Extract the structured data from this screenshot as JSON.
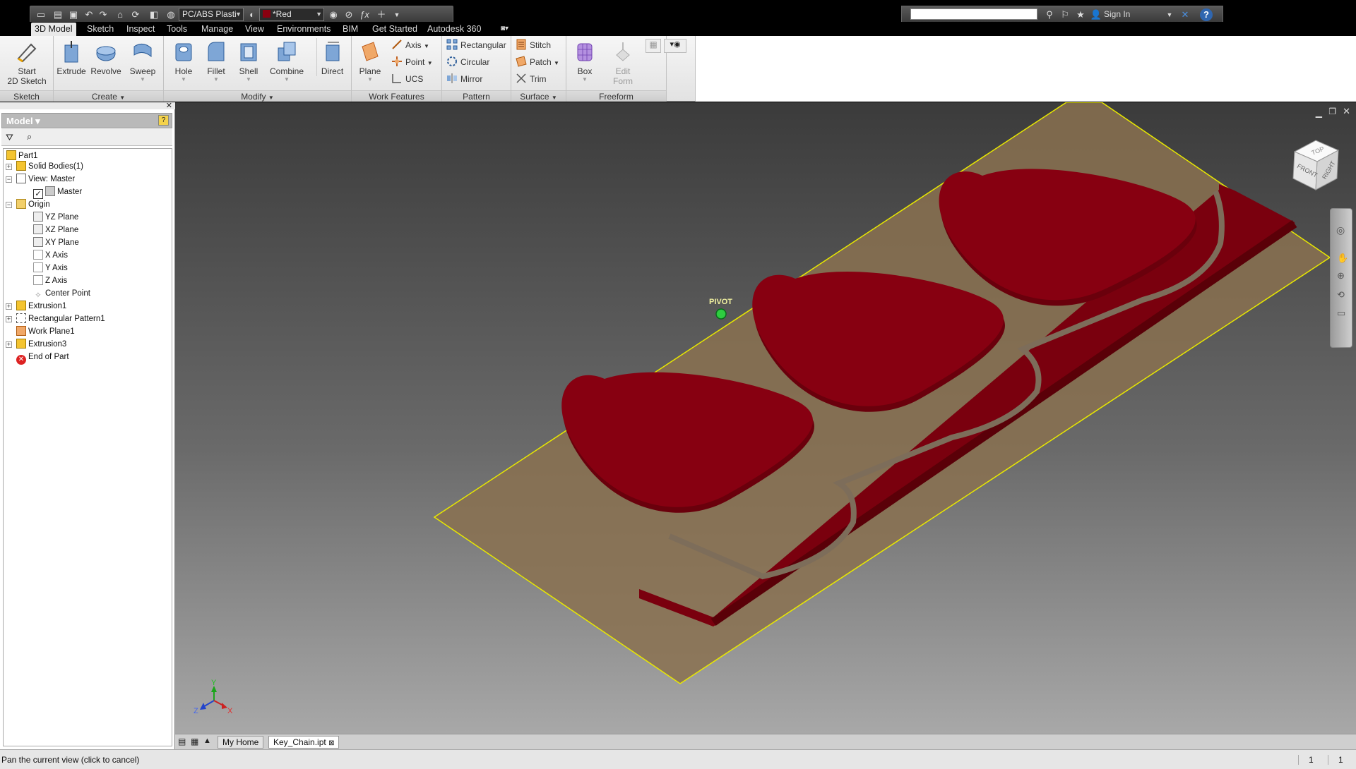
{
  "qat": {
    "material": "PC/ABS Plasti",
    "appearance": "*Red",
    "sign_in": "Sign In",
    "search_placeholder": ""
  },
  "tabs": [
    "3D Model",
    "Sketch",
    "Inspect",
    "Tools",
    "Manage",
    "View",
    "Environments",
    "BIM",
    "Get Started",
    "Autodesk 360"
  ],
  "ribbon": {
    "sketch": {
      "start_line1": "Start",
      "start_line2": "2D Sketch",
      "label": "Sketch"
    },
    "create": {
      "extrude": "Extrude",
      "revolve": "Revolve",
      "sweep": "Sweep",
      "label": "Create"
    },
    "modify": {
      "hole": "Hole",
      "fillet": "Fillet",
      "shell": "Shell",
      "combine": "Combine",
      "direct": "Direct",
      "label": "Modify"
    },
    "work_features": {
      "plane": "Plane",
      "axis": "Axis",
      "point": "Point",
      "ucs": "UCS",
      "label": "Work Features"
    },
    "pattern": {
      "rectangular": "Rectangular",
      "circular": "Circular",
      "mirror": "Mirror",
      "label": "Pattern"
    },
    "surface": {
      "stitch": "Stitch",
      "patch": "Patch",
      "trim": "Trim",
      "label": "Surface"
    },
    "freeform": {
      "box": "Box",
      "edit_line1": "Edit",
      "edit_line2": "Form",
      "label": "Freeform"
    }
  },
  "browser": {
    "title": "Model",
    "tree": [
      {
        "label": "Part1",
        "icon": "part-icon"
      },
      {
        "label": "Solid Bodies(1)",
        "icon": "solid-bodies-icon"
      },
      {
        "label": "View: Master",
        "icon": "view-icon"
      },
      {
        "label": "Master",
        "icon": "lock-icon"
      },
      {
        "label": "Origin",
        "icon": "folder-icon"
      },
      {
        "label": "YZ Plane",
        "icon": "plane-icon"
      },
      {
        "label": "XZ Plane",
        "icon": "plane-icon"
      },
      {
        "label": "XY Plane",
        "icon": "plane-icon"
      },
      {
        "label": "X Axis",
        "icon": "axis-icon"
      },
      {
        "label": "Y Axis",
        "icon": "axis-icon"
      },
      {
        "label": "Z Axis",
        "icon": "axis-icon"
      },
      {
        "label": "Center Point",
        "icon": "point-icon"
      },
      {
        "label": "Extrusion1",
        "icon": "extrusion-icon"
      },
      {
        "label": "Rectangular Pattern1",
        "icon": "pattern-icon"
      },
      {
        "label": "Work Plane1",
        "icon": "workplane-icon"
      },
      {
        "label": "Extrusion3",
        "icon": "extrusion-icon"
      },
      {
        "label": "End of Part",
        "icon": "end-of-part-icon"
      }
    ]
  },
  "viewport": {
    "annotation": "PIVOT",
    "viewcube": {
      "top": "TOP",
      "front": "FRONT",
      "right": "RIGHT"
    },
    "triad": {
      "x": "X",
      "y": "Y",
      "z": "Z"
    },
    "colors": {
      "body": "#8b0010",
      "plane": "#8a7150",
      "plane_edge": "#e8e800"
    }
  },
  "doc_tabs": {
    "home": "My Home",
    "file": "Key_Chain.ipt"
  },
  "status": {
    "message": "Pan the current view (click to cancel)",
    "count1": "1",
    "count2": "1"
  }
}
